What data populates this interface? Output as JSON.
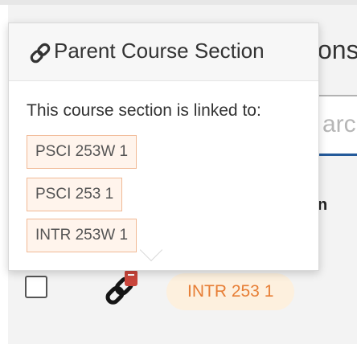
{
  "page": {
    "heading_fragment": "ons",
    "search_fragment": "arch",
    "column_header_fragment": "n"
  },
  "row": {
    "section_badge": "INTR 253 1",
    "link_icon": "link-icon",
    "badge_colors": {
      "background": "#fdf0de",
      "text": "#e77e35"
    }
  },
  "popover": {
    "title_icon": "link-icon",
    "title": "Parent Course Section",
    "description": "This course section is linked to:",
    "linked_sections": [
      "PSCI 253W 1",
      "PSCI 253 1",
      "INTR 253W 1"
    ],
    "tag_colors": {
      "border": "#f1b995",
      "background": "#fff4ec"
    }
  }
}
